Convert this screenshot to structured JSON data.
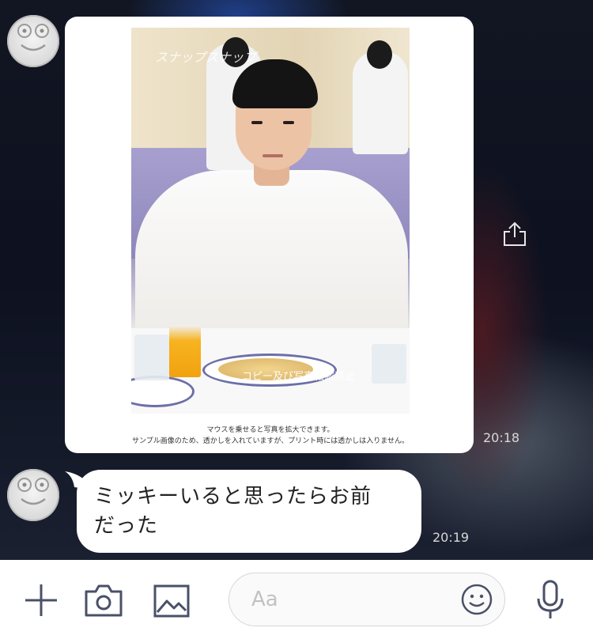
{
  "colors": {
    "accent_icon": "#4a5068",
    "chat_background": "#0c0f18",
    "bubble": "#ffffff"
  },
  "messages": [
    {
      "type": "image",
      "sender_avatar": "frog-avatar",
      "photo": {
        "watermark_top": "スナップスナップ",
        "watermark_center": "コピー及び写真転載禁止",
        "caption_line1": "マウスを乗せると写真を拡大できます。",
        "caption_line2": "サンプル画像のため、透かしを入れていますが、プリント時には透かしは入りません。"
      },
      "time": "20:18"
    },
    {
      "type": "text",
      "sender_avatar": "frog-avatar",
      "text_line1": "ミッキーいると思ったらお前",
      "text_line2": "だった",
      "time": "20:19"
    }
  ],
  "input_bar": {
    "placeholder": "Aa",
    "icons": [
      "plus-icon",
      "camera-icon",
      "image-icon",
      "emoji-icon",
      "microphone-icon"
    ]
  }
}
